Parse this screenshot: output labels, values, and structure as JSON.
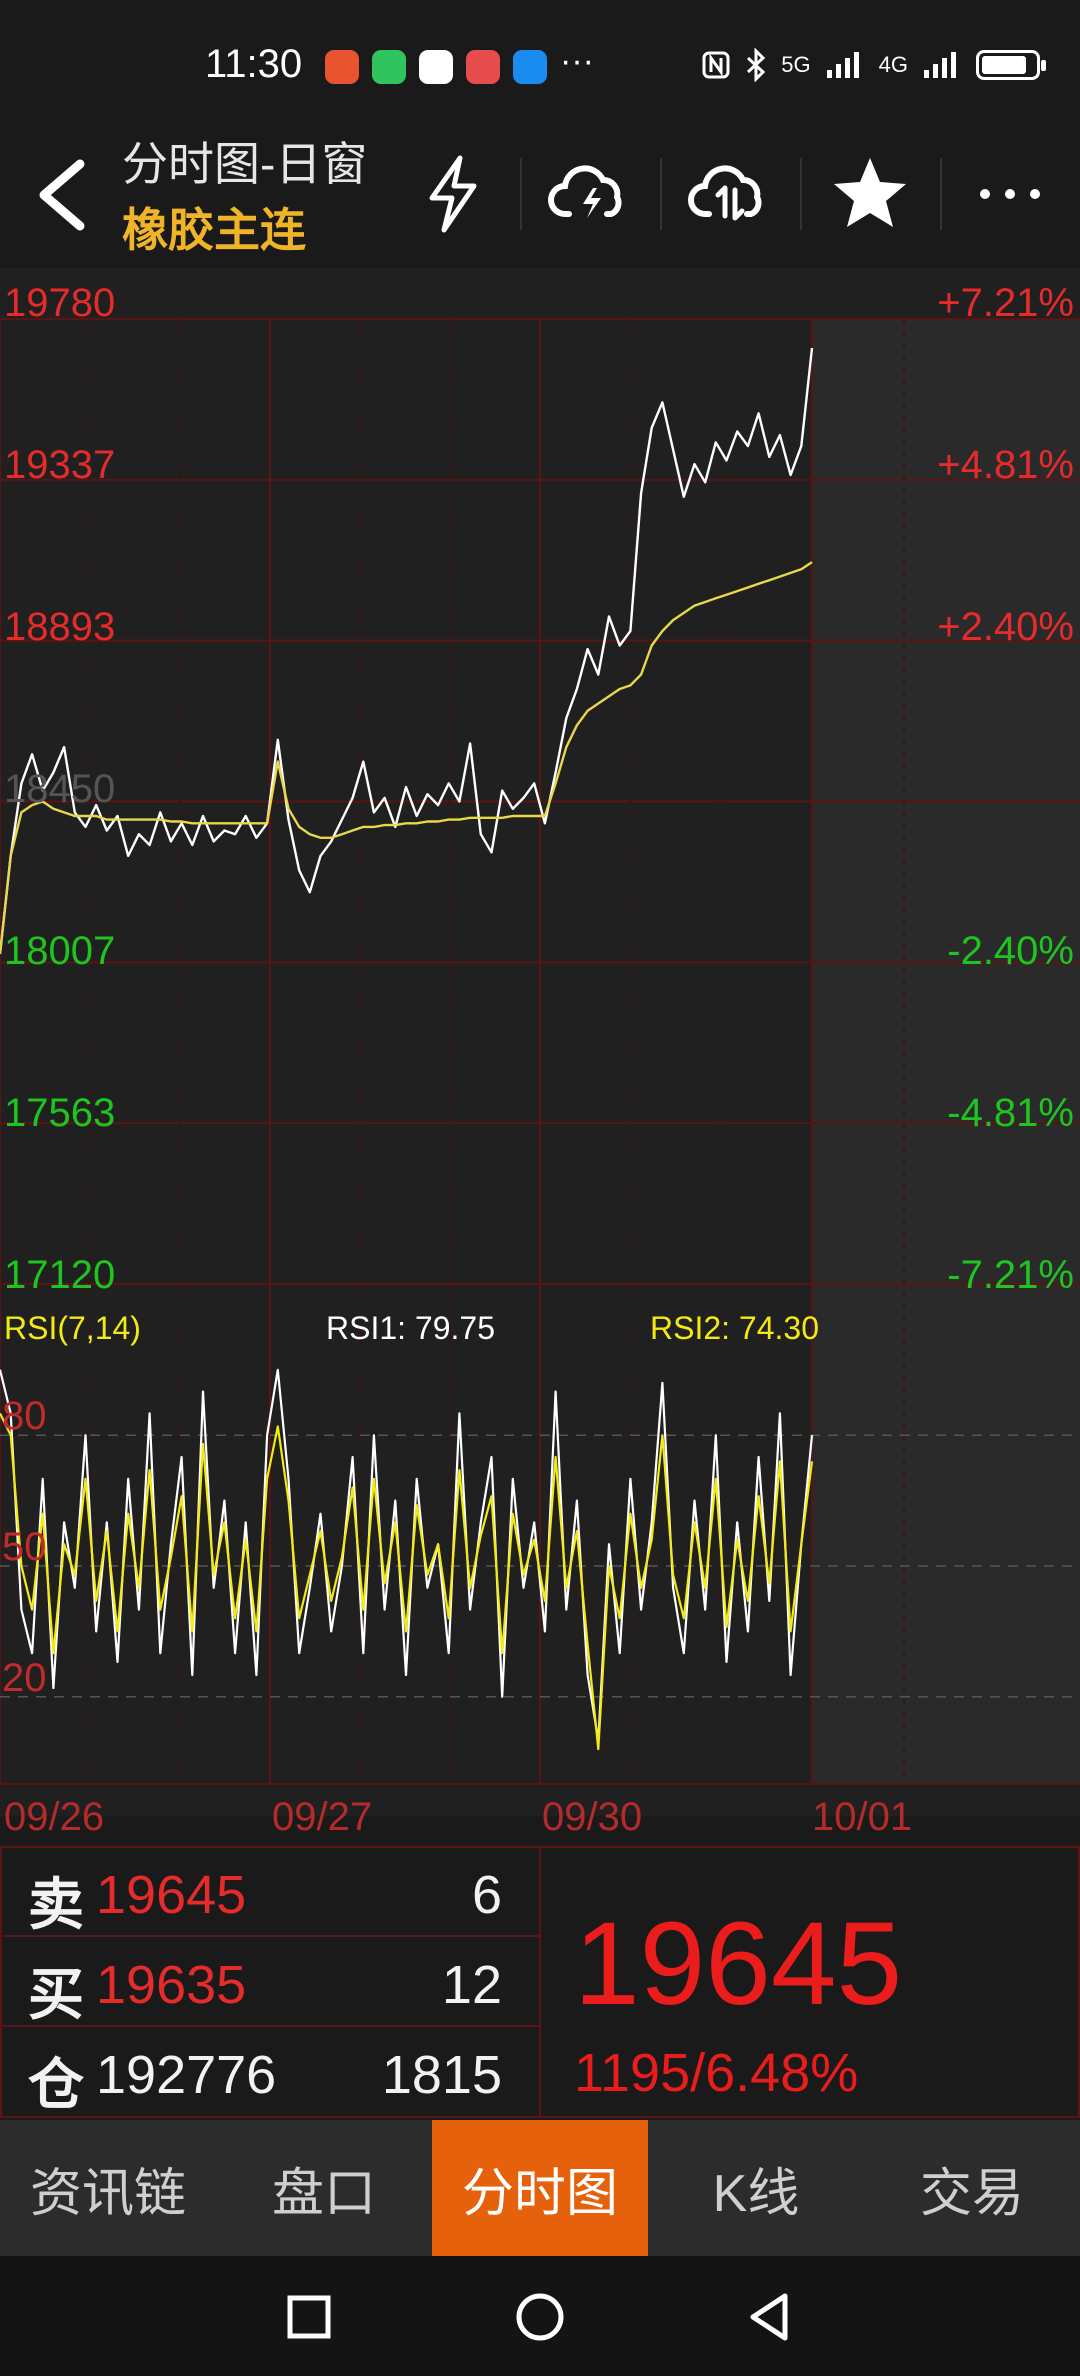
{
  "status": {
    "time": "11:30",
    "signal_labels": [
      "5G",
      "4G"
    ],
    "more": "···",
    "app_colors": [
      "#e8542f",
      "#2fc45e",
      "#ffffff",
      "#e84d4d",
      "#1a8cf0"
    ]
  },
  "header": {
    "title": "分时图-日窗",
    "subtitle": "橡胶主连",
    "icons": [
      "back-icon",
      "lightning-icon",
      "cloud-lightning-icon",
      "cloud-sync-icon",
      "star-icon",
      "more-icon"
    ]
  },
  "chart_data": [
    {
      "type": "line",
      "name": "intraday",
      "y_ticks_left": [
        "19780",
        "19337",
        "18893",
        "18450",
        "18007",
        "17563",
        "17120"
      ],
      "y_ticks_right": [
        "+7.21%",
        "+4.81%",
        "+2.40%",
        "",
        "-2.40%",
        "-4.81%",
        "-7.21%"
      ],
      "ylim": [
        17120,
        19780
      ],
      "base": 18450,
      "x_labels": [
        "09/26",
        "09/27",
        "09/30",
        "10/01"
      ],
      "series": [
        {
          "name": "price",
          "color": "#ffffff",
          "values": [
            18030,
            18300,
            18500,
            18580,
            18480,
            18530,
            18600,
            18420,
            18380,
            18440,
            18370,
            18410,
            18300,
            18360,
            18330,
            18420,
            18340,
            18390,
            18330,
            18410,
            18340,
            18370,
            18360,
            18410,
            18350,
            18390,
            18620,
            18400,
            18260,
            18200,
            18300,
            18340,
            18400,
            18460,
            18560,
            18420,
            18460,
            18380,
            18490,
            18410,
            18470,
            18440,
            18500,
            18450,
            18610,
            18360,
            18310,
            18480,
            18430,
            18460,
            18500,
            18390,
            18530,
            18680,
            18760,
            18870,
            18800,
            18960,
            18880,
            18920,
            19300,
            19480,
            19550,
            19420,
            19290,
            19380,
            19330,
            19440,
            19390,
            19470,
            19430,
            19520,
            19400,
            19460,
            19350,
            19430,
            19700
          ]
        },
        {
          "name": "avg",
          "color": "#e8d84a",
          "values": [
            18030,
            18300,
            18420,
            18440,
            18450,
            18430,
            18420,
            18410,
            18410,
            18410,
            18400,
            18400,
            18400,
            18400,
            18400,
            18400,
            18395,
            18395,
            18390,
            18390,
            18390,
            18390,
            18390,
            18390,
            18390,
            18390,
            18560,
            18430,
            18380,
            18360,
            18350,
            18350,
            18360,
            18370,
            18380,
            18380,
            18385,
            18385,
            18390,
            18390,
            18395,
            18395,
            18400,
            18400,
            18405,
            18405,
            18405,
            18405,
            18410,
            18410,
            18410,
            18410,
            18500,
            18600,
            18660,
            18700,
            18720,
            18740,
            18760,
            18770,
            18800,
            18880,
            18920,
            18950,
            18970,
            18990,
            19000,
            19010,
            19020,
            19030,
            19040,
            19050,
            19060,
            19070,
            19080,
            19090,
            19110
          ]
        }
      ]
    },
    {
      "type": "line",
      "name": "RSI(7,14)",
      "title": "RSI(7,14)",
      "rsi1_label": "RSI1: 79.75",
      "rsi2_label": "RSI2: 74.30",
      "y_ticks": [
        "80",
        "50",
        "20"
      ],
      "ylim": [
        0,
        100
      ],
      "series": [
        {
          "name": "RSI1",
          "color": "#ffffff",
          "values": [
            95,
            85,
            40,
            30,
            70,
            22,
            60,
            45,
            80,
            35,
            60,
            28,
            70,
            40,
            85,
            30,
            55,
            75,
            25,
            90,
            45,
            65,
            30,
            60,
            25,
            80,
            95,
            70,
            30,
            45,
            62,
            35,
            50,
            75,
            30,
            80,
            40,
            65,
            25,
            70,
            45,
            55,
            30,
            85,
            40,
            60,
            75,
            20,
            70,
            45,
            60,
            35,
            90,
            40,
            65,
            25,
            10,
            55,
            30,
            70,
            40,
            60,
            92,
            45,
            30,
            65,
            40,
            80,
            28,
            60,
            35,
            75,
            42,
            85,
            25,
            55,
            80
          ]
        },
        {
          "name": "RSI2",
          "color": "#f2ea12",
          "values": [
            85,
            80,
            50,
            40,
            62,
            30,
            55,
            48,
            70,
            42,
            58,
            35,
            62,
            45,
            72,
            40,
            52,
            66,
            35,
            78,
            48,
            60,
            38,
            56,
            35,
            70,
            82,
            65,
            38,
            48,
            58,
            42,
            52,
            68,
            40,
            70,
            46,
            60,
            35,
            64,
            48,
            55,
            38,
            72,
            45,
            57,
            66,
            30,
            62,
            48,
            56,
            42,
            75,
            45,
            58,
            32,
            8,
            50,
            38,
            62,
            45,
            56,
            80,
            48,
            38,
            60,
            45,
            70,
            36,
            56,
            42,
            66,
            46,
            74,
            35,
            55,
            74
          ]
        }
      ]
    }
  ],
  "quote": {
    "sell_label": "卖",
    "sell_price": "19645",
    "sell_qty": "6",
    "buy_label": "买",
    "buy_price": "19635",
    "buy_qty": "12",
    "oi_label": "仓",
    "oi_value": "192776",
    "oi_change": "1815",
    "last_price": "19645",
    "change": "1195/6.48%"
  },
  "tabs": [
    {
      "label": "资讯链",
      "active": false
    },
    {
      "label": "盘口",
      "active": false
    },
    {
      "label": "分时图",
      "active": true
    },
    {
      "label": "K线",
      "active": false
    },
    {
      "label": "交易",
      "active": false
    }
  ],
  "colors": {
    "up": "#e52b2b",
    "down": "#1fc51f",
    "accent": "#e5610c",
    "title": "#f0b429",
    "grid": "#5a1414"
  }
}
